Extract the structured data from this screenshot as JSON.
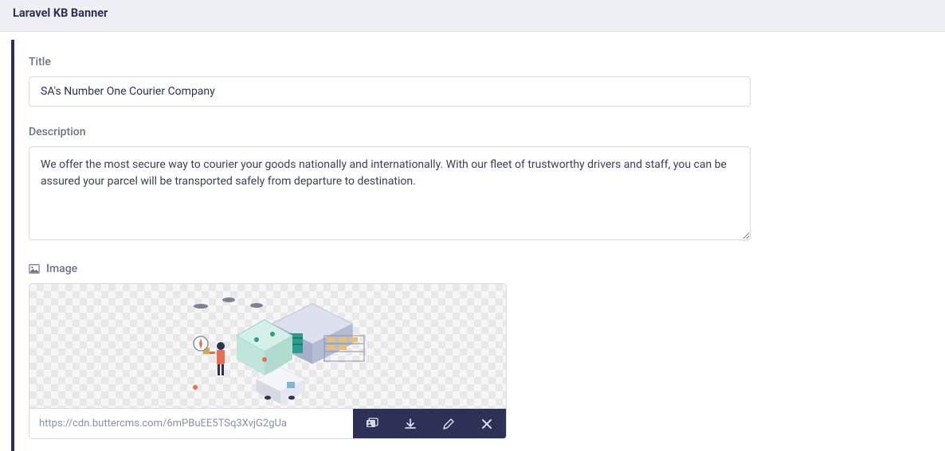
{
  "header": {
    "title": "Laravel KB Banner"
  },
  "fields": {
    "title": {
      "label": "Title",
      "value": "SA's Number One Courier Company"
    },
    "description": {
      "label": "Description",
      "value": "We offer the most secure way to courier your goods nationally and internationally. With our fleet of trustworthy drivers and staff, you can be assured your parcel will be transported safely from departure to destination."
    },
    "image": {
      "label": "Image",
      "url": "https://cdn.buttercms.com/6mPBuEE5TSq3XvjG2gUa"
    }
  }
}
